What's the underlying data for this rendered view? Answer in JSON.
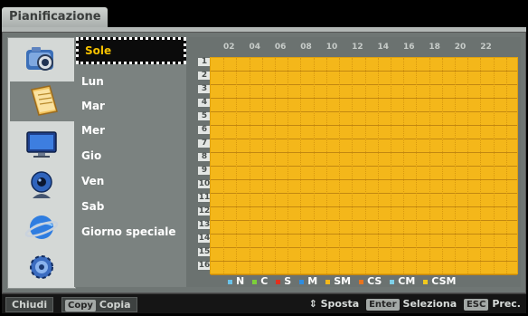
{
  "window": {
    "title": "Pianificazione"
  },
  "icons": [
    {
      "name": "camera-icon",
      "active": false
    },
    {
      "name": "schedule-icon",
      "active": true
    },
    {
      "name": "display-icon",
      "active": false
    },
    {
      "name": "webcam-icon",
      "active": false
    },
    {
      "name": "network-icon",
      "active": false
    },
    {
      "name": "settings-icon",
      "active": false
    }
  ],
  "days": [
    "Sole",
    "Lun",
    "Mar",
    "Mer",
    "Gio",
    "Ven",
    "Sab",
    "Giorno speciale"
  ],
  "selected_day": "Sole",
  "hours": [
    "02",
    "04",
    "06",
    "08",
    "10",
    "12",
    "14",
    "16",
    "18",
    "20",
    "22"
  ],
  "rows": [
    "1",
    "2",
    "3",
    "4",
    "5",
    "6",
    "7",
    "8",
    "9",
    "10",
    "11",
    "12",
    "13",
    "14",
    "15",
    "16"
  ],
  "grid_color": "#f4b71a",
  "legend": [
    {
      "label": "N",
      "color": "#6ac3ea"
    },
    {
      "label": "C",
      "color": "#7ccf3a"
    },
    {
      "label": "S",
      "color": "#e0301e"
    },
    {
      "label": "M",
      "color": "#2e8de0"
    },
    {
      "label": "SM",
      "color": "#f4b71a"
    },
    {
      "label": "CS",
      "color": "#e8741e"
    },
    {
      "label": "CM",
      "color": "#7fd0e8"
    },
    {
      "label": "CSM",
      "color": "#f0c81e"
    }
  ],
  "bottom": {
    "close_label": "Chiudi",
    "copy_chip": "Copy",
    "copy_label": "Copia",
    "move_symbol": "⇕",
    "move_label": "Sposta",
    "enter_chip": "Enter",
    "select_label": "Seleziona",
    "esc_chip": "ESC",
    "prev_label": "Prec."
  }
}
